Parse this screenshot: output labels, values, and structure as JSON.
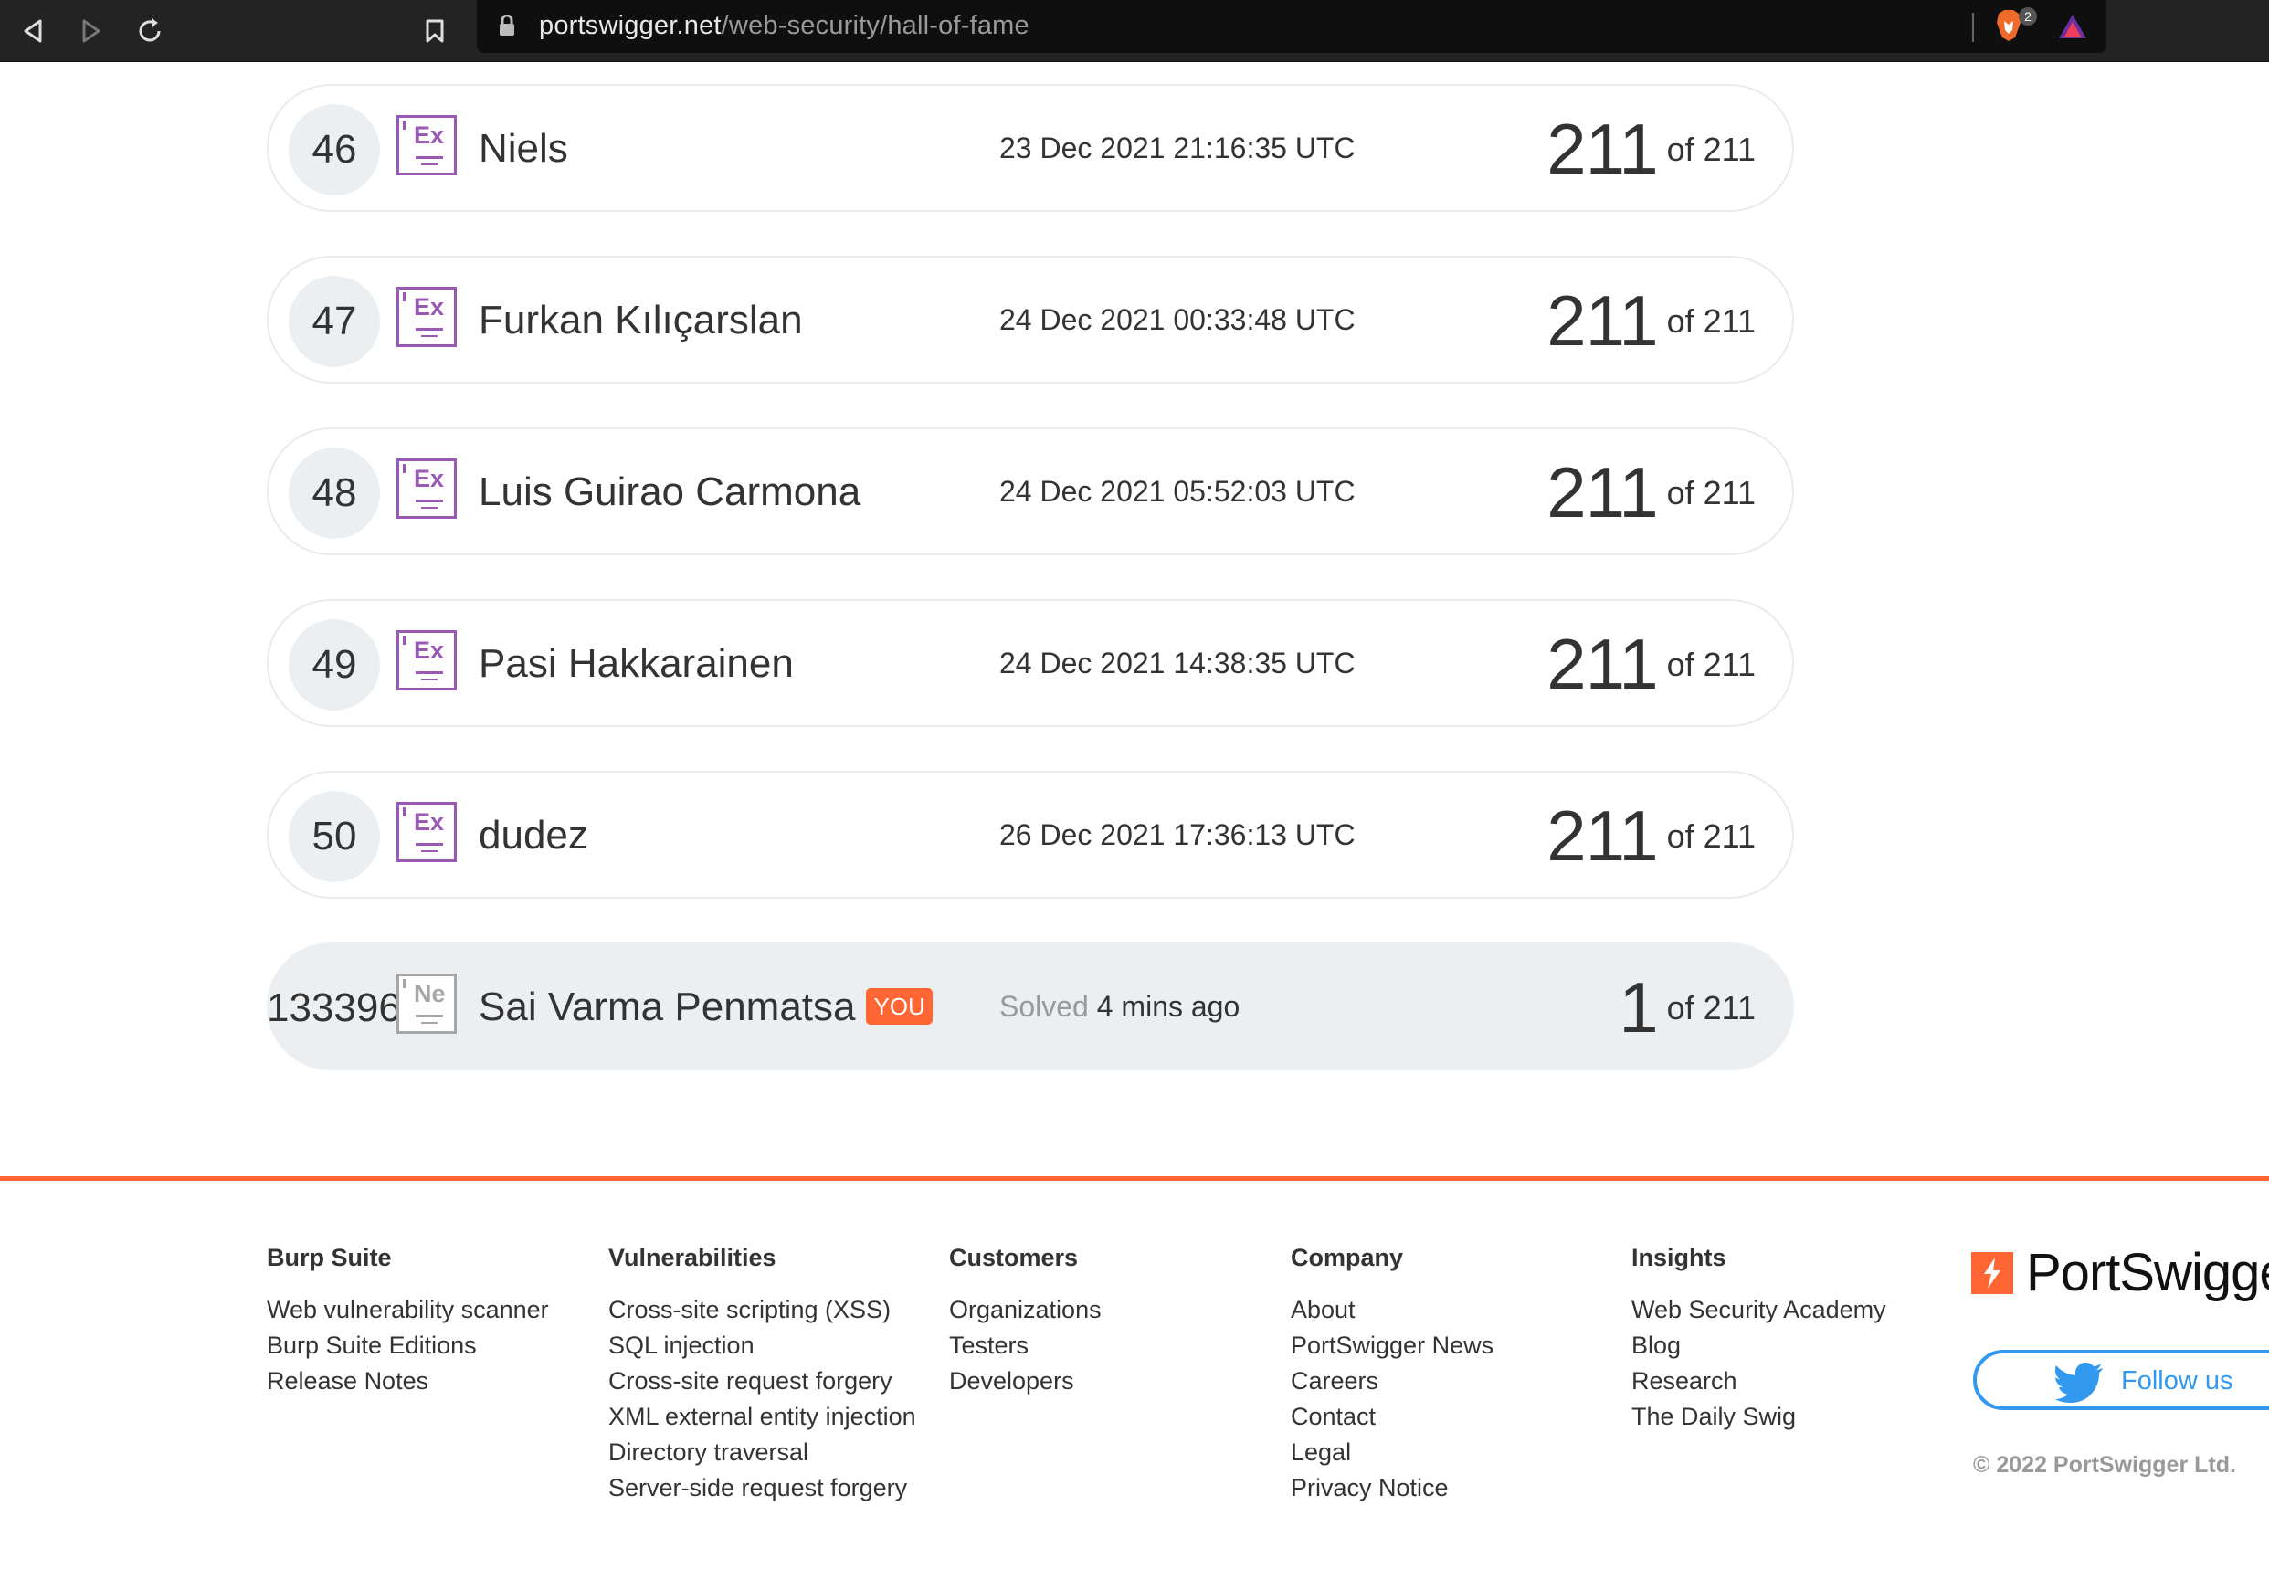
{
  "browser": {
    "url_host": "portswigger.net",
    "url_path": "/web-security/hall-of-fame",
    "extension_badge": "2"
  },
  "leaderboard": [
    {
      "rank": "46",
      "level": "Ex",
      "name": "Niels",
      "date": "23 Dec 2021 21:16:35 UTC",
      "score": "211",
      "of": "of 211"
    },
    {
      "rank": "47",
      "level": "Ex",
      "name": "Furkan Kılıçarslan",
      "date": "24 Dec 2021 00:33:48 UTC",
      "score": "211",
      "of": "of 211"
    },
    {
      "rank": "48",
      "level": "Ex",
      "name": "Luis Guirao Carmona",
      "date": "24 Dec 2021 05:52:03 UTC",
      "score": "211",
      "of": "of 211"
    },
    {
      "rank": "49",
      "level": "Ex",
      "name": "Pasi Hakkarainen",
      "date": "24 Dec 2021 14:38:35 UTC",
      "score": "211",
      "of": "of 211"
    },
    {
      "rank": "50",
      "level": "Ex",
      "name": "dudez",
      "date": "26 Dec 2021 17:36:13 UTC",
      "score": "211",
      "of": "of 211"
    }
  ],
  "current_user": {
    "rank": "133396",
    "level": "Ne",
    "name": "Sai Varma Penmatsa",
    "badge": "YOU",
    "solved_label": "Solved",
    "solved_time": "4 mins ago",
    "score": "1",
    "of": "of 211"
  },
  "footer": {
    "columns": [
      {
        "heading": "Burp Suite",
        "links": [
          "Web vulnerability scanner",
          "Burp Suite Editions",
          "Release Notes"
        ]
      },
      {
        "heading": "Vulnerabilities",
        "links": [
          "Cross-site scripting (XSS)",
          "SQL injection",
          "Cross-site request forgery",
          "XML external entity injection",
          "Directory traversal",
          "Server-side request forgery"
        ]
      },
      {
        "heading": "Customers",
        "links": [
          "Organizations",
          "Testers",
          "Developers"
        ]
      },
      {
        "heading": "Company",
        "links": [
          "About",
          "PortSwigger News",
          "Careers",
          "Contact",
          "Legal",
          "Privacy Notice"
        ]
      },
      {
        "heading": "Insights",
        "links": [
          "Web Security Academy",
          "Blog",
          "Research",
          "The Daily Swig"
        ]
      }
    ],
    "brand": "PortSwigger",
    "follow_label": "Follow us",
    "copyright": "© 2022 PortSwigger Ltd."
  },
  "colors": {
    "accent": "#ff6633",
    "level_expert": "#9b59b6",
    "twitter": "#3399ee"
  }
}
